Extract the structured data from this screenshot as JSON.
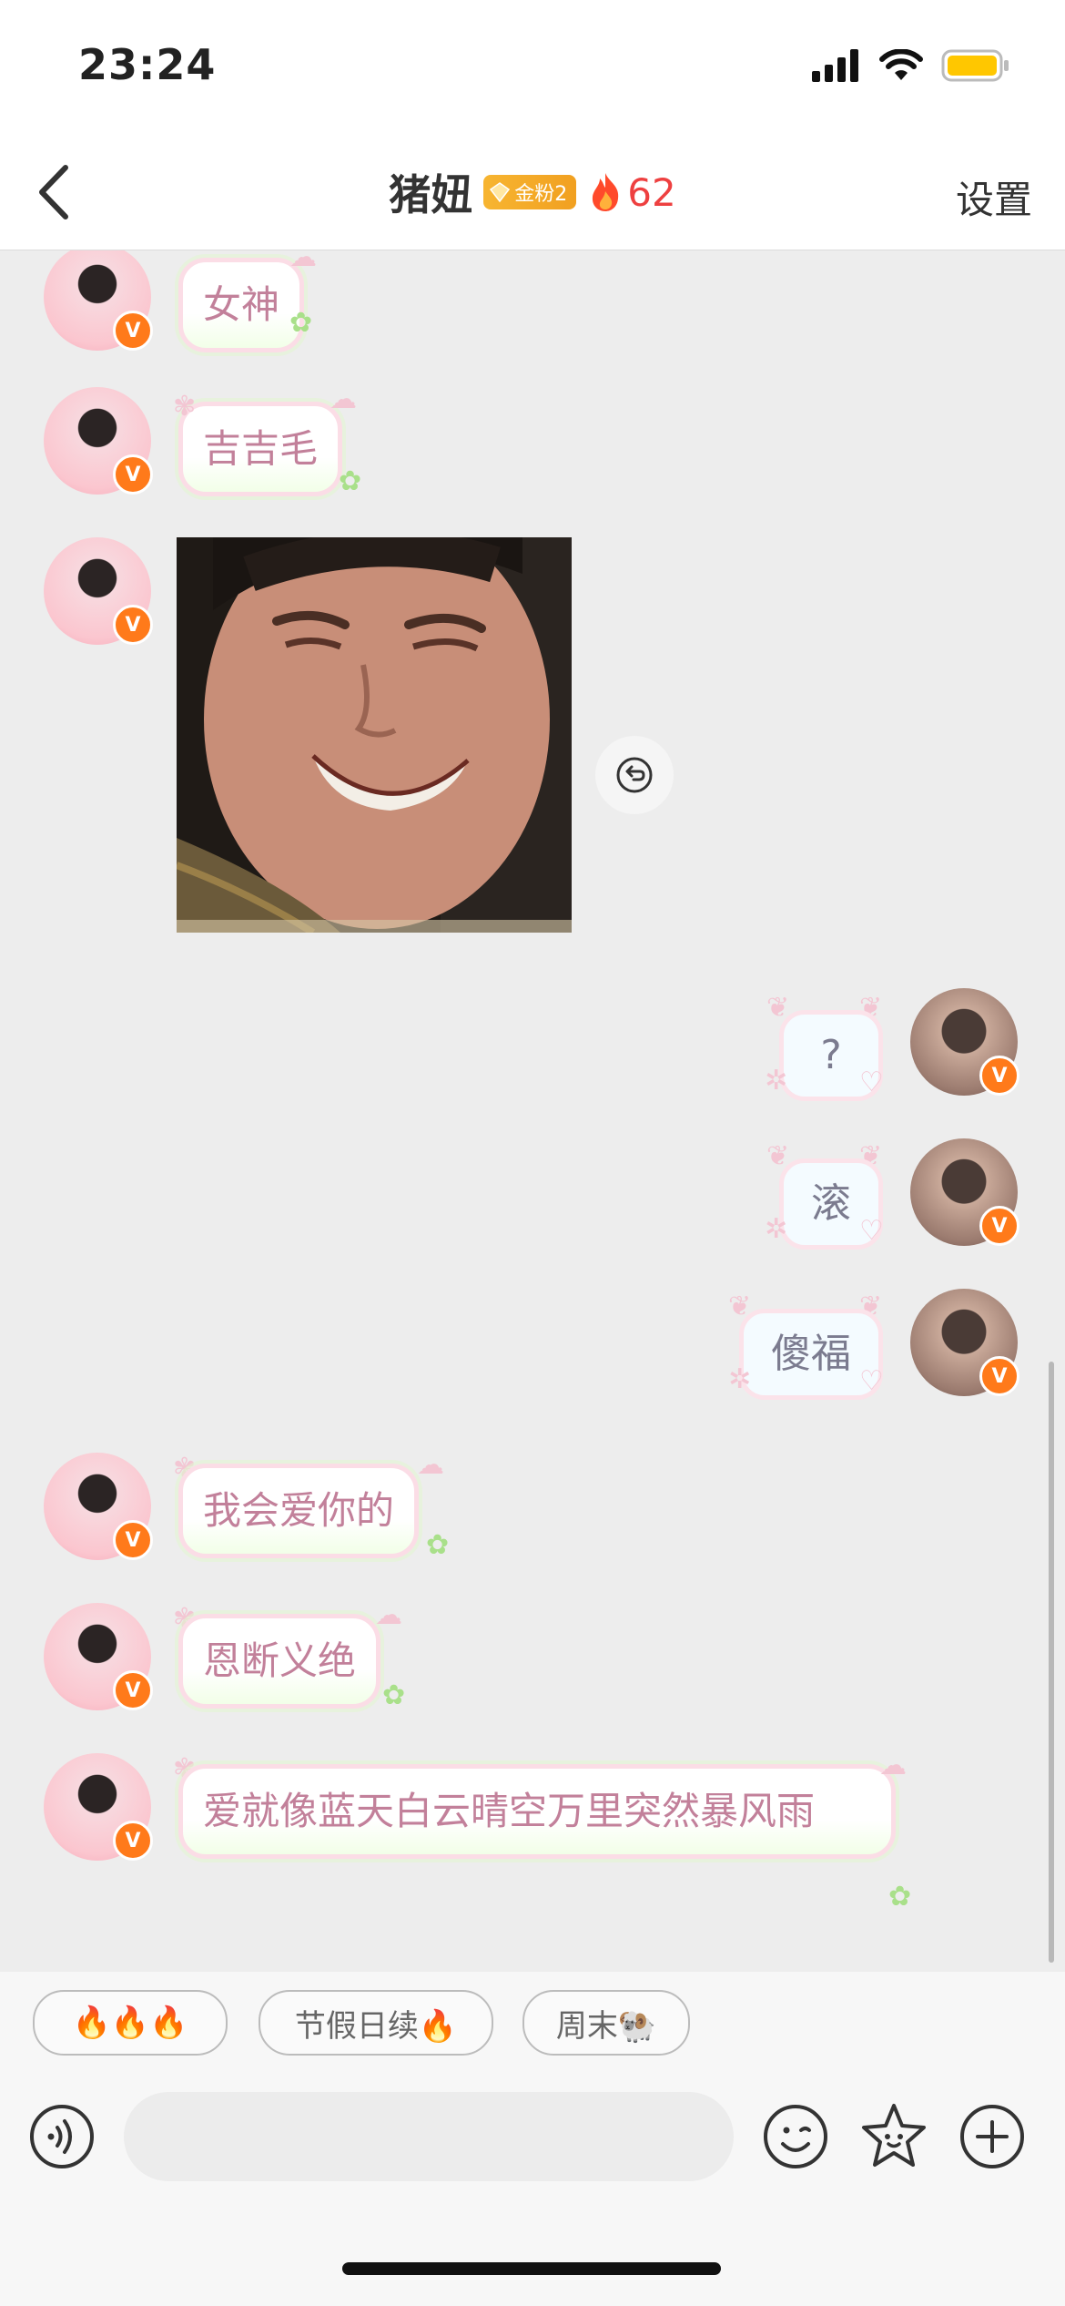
{
  "status_bar": {
    "time": "23:24",
    "battery_color": "#ffc700"
  },
  "nav": {
    "back_icon": "chevron-left-icon",
    "title": "猪妞",
    "fan_badge": "金粉2",
    "fire_count": "62",
    "settings_label": "设置"
  },
  "messages": [
    {
      "side": "left",
      "type": "text",
      "text": "女神"
    },
    {
      "side": "left",
      "type": "text",
      "text": "吉吉毛"
    },
    {
      "side": "left",
      "type": "image",
      "content": "crying-laughing-man-photo"
    },
    {
      "side": "right",
      "type": "text",
      "text": "?"
    },
    {
      "side": "right",
      "type": "text",
      "text": "滚"
    },
    {
      "side": "right",
      "type": "text",
      "text": "傻福"
    },
    {
      "side": "left",
      "type": "text",
      "text": "我会爱你的"
    },
    {
      "side": "left",
      "type": "text",
      "text": "恩断义绝"
    },
    {
      "side": "left",
      "type": "text",
      "text": "爱就像蓝天白云晴空万里突然暴风雨"
    }
  ],
  "verified_badge": "V",
  "quick_replies": [
    "🔥🔥🔥",
    "节假日续🔥",
    "周末🐏"
  ],
  "input": {
    "placeholder": ""
  },
  "input_icons": [
    "voice-icon",
    "emoji-icon",
    "sticker-icon",
    "plus-icon"
  ]
}
